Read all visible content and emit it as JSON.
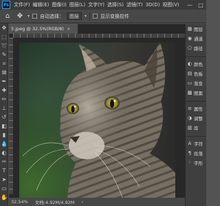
{
  "menu": {
    "logo": "Ps",
    "items": [
      "文件(F)",
      "编辑(E)",
      "图像(I)",
      "图层(L)",
      "文字(Y)",
      "选择(S)",
      "滤镜(T)",
      "3D(D)",
      "视图(V)",
      "增效工具",
      "窗口(W)"
    ]
  },
  "window_controls": {
    "minimize": "—",
    "maximize": "□"
  },
  "options": {
    "auto_select_label": "自动选择：",
    "layer_select": "图层",
    "show_transform_label": "显示变换控件"
  },
  "document": {
    "tab_title": "5.jpeg @ 32.5%(RGB/8)",
    "tab_close": "×",
    "zoom": "32.54%",
    "doc_info": "文档:4.92M/4.92M",
    "status_arrow": "›"
  },
  "right_panel": {
    "items": [
      {
        "icon": "layers-icon",
        "glyph": "▦",
        "label": "图层"
      },
      {
        "icon": "channels-icon",
        "glyph": "◉",
        "label": "通道"
      },
      {
        "icon": "paths-icon",
        "glyph": "⬠",
        "label": "路径"
      },
      {
        "icon": "color-icon",
        "glyph": "◐",
        "label": "颜色"
      },
      {
        "icon": "swatches-icon",
        "glyph": "▤",
        "label": "色板"
      },
      {
        "icon": "gradient-icon",
        "glyph": "▭",
        "label": "渐变"
      },
      {
        "icon": "pattern-icon",
        "glyph": "▩",
        "label": "图案"
      },
      {
        "icon": "properties-icon",
        "glyph": "≡",
        "label": "属性"
      },
      {
        "icon": "adjustments-icon",
        "glyph": "◑",
        "label": "调整"
      },
      {
        "icon": "libraries-icon",
        "glyph": "▥",
        "label": "库"
      },
      {
        "icon": "character-icon",
        "glyph": "A",
        "label": "字符"
      },
      {
        "icon": "paragraph-icon",
        "glyph": "¶",
        "label": "段落"
      },
      {
        "icon": "glyph-icon",
        "glyph": "ʲ",
        "label": "字形"
      }
    ]
  },
  "tools": [
    "move",
    "marquee",
    "lasso",
    "quick-select",
    "crop",
    "frame",
    "eyedropper",
    "healing",
    "brush",
    "stamp",
    "history-brush",
    "eraser",
    "gradient",
    "blur",
    "dodge",
    "pen",
    "type",
    "path-select",
    "shape",
    "hand",
    "zoom"
  ]
}
